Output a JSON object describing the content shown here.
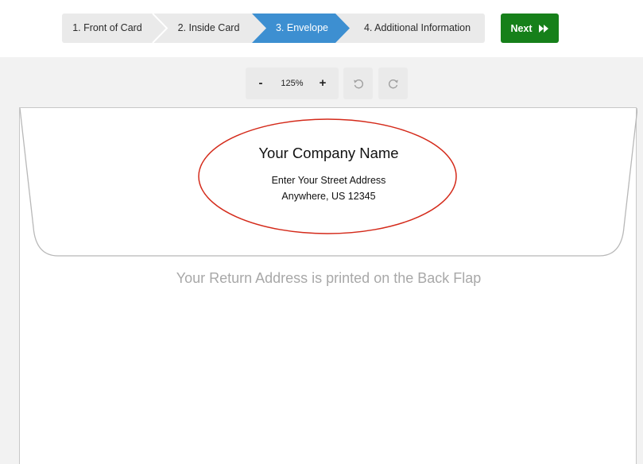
{
  "steps": [
    {
      "label": "1. Front of Card",
      "active": false
    },
    {
      "label": "2. Inside Card",
      "active": false
    },
    {
      "label": "3. Envelope",
      "active": true
    },
    {
      "label": "4. Additional Information",
      "active": false
    }
  ],
  "next_button": {
    "label": "Next",
    "icon": "fast-forward-icon"
  },
  "zoom": {
    "minus_label": "-",
    "value": "125%",
    "plus_label": "+"
  },
  "history": {
    "undo_icon": "undo-icon",
    "redo_icon": "redo-icon"
  },
  "envelope": {
    "company_name": "Your Company Name",
    "street": "Enter Your Street Address",
    "city_line": "Anywhere, US  12345",
    "flap_note": "Your Return Address is printed on the Back Flap"
  },
  "colors": {
    "active_step": "#3d8fd1",
    "next_button": "#16801a",
    "highlight_ring": "#d42a1a"
  }
}
